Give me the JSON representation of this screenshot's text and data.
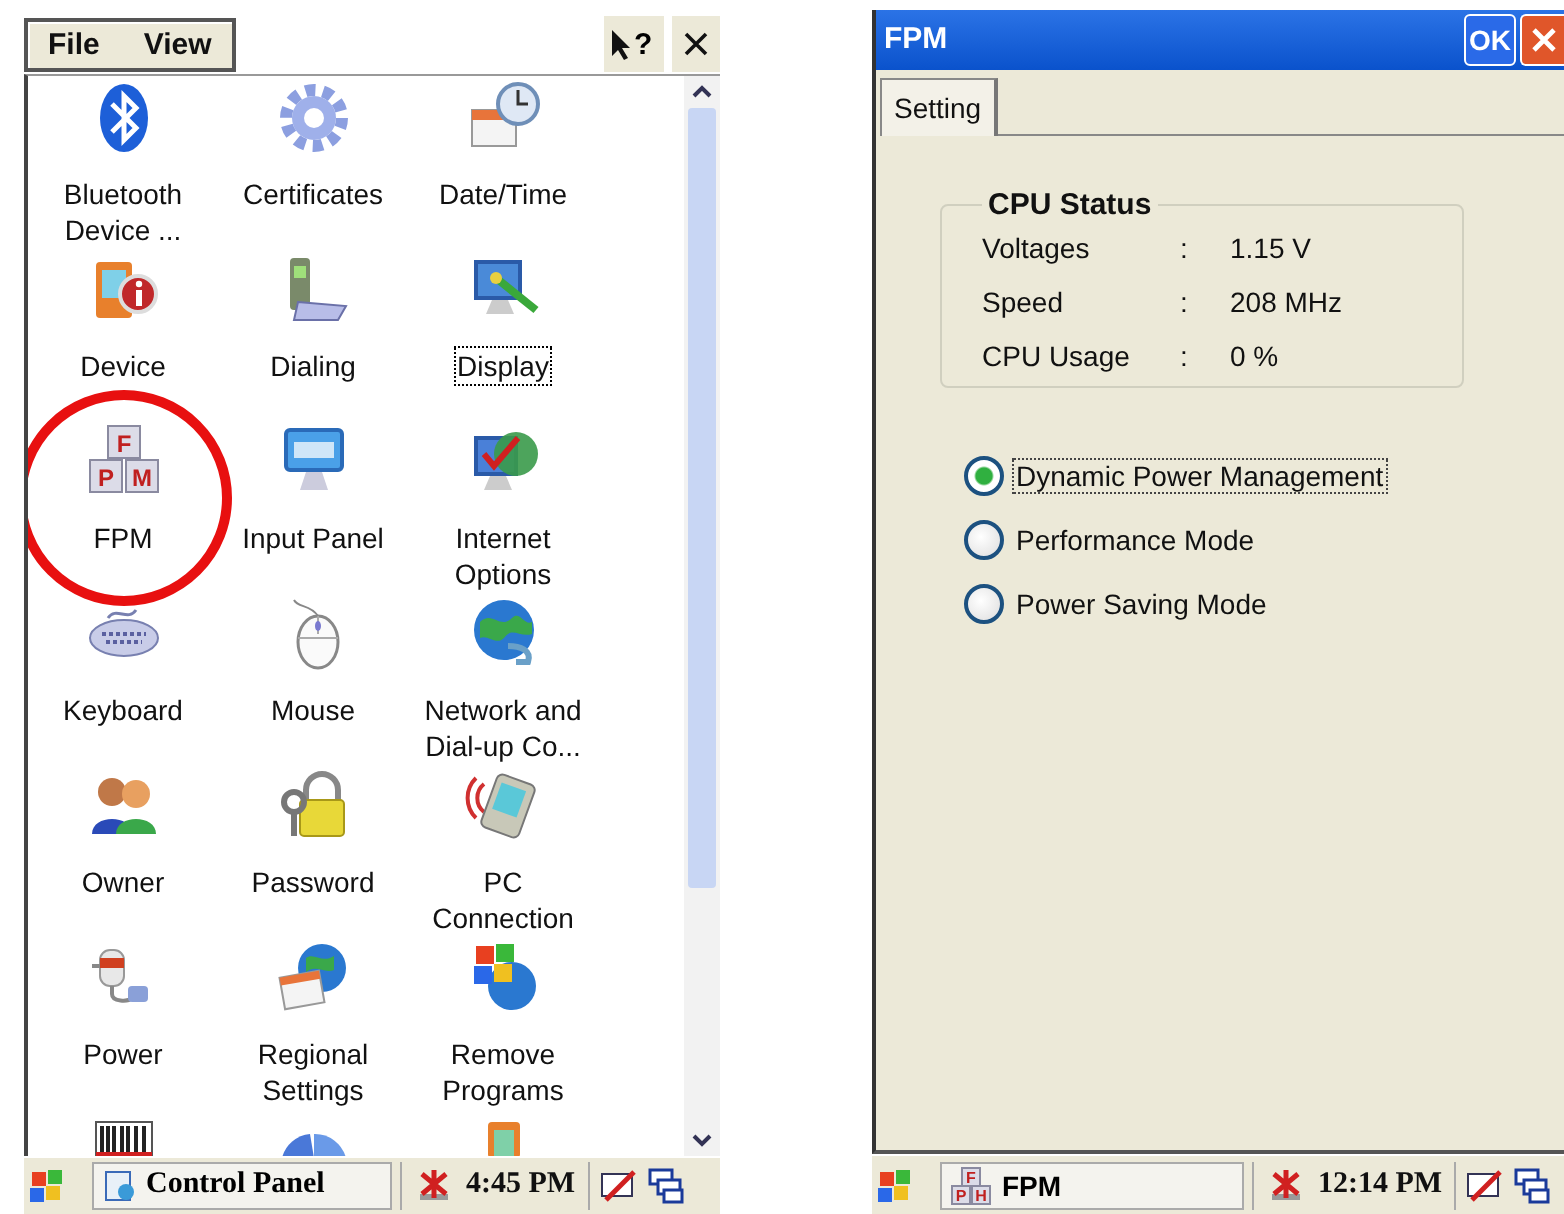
{
  "control_panel": {
    "menu": [
      {
        "label": "File"
      },
      {
        "label": "View"
      }
    ],
    "help_glyph": "?",
    "items": [
      {
        "label": "Bluetooth Device ...",
        "kind": "bluetooth",
        "selected": false,
        "circled": false
      },
      {
        "label": "Certificates",
        "kind": "gear",
        "selected": false,
        "circled": false
      },
      {
        "label": "Date/Time",
        "kind": "calendar-clock",
        "selected": false,
        "circled": false
      },
      {
        "label": "Device",
        "kind": "handheld-info",
        "selected": false,
        "circled": false
      },
      {
        "label": "Dialing",
        "kind": "phone-modem",
        "selected": false,
        "circled": false
      },
      {
        "label": "Display",
        "kind": "monitor-wand",
        "selected": true,
        "circled": false
      },
      {
        "label": "FPM",
        "kind": "letter-blocks",
        "icon_letters": [
          "F",
          "P",
          "M"
        ],
        "selected": false,
        "circled": true
      },
      {
        "label": "Input Panel",
        "kind": "monitor",
        "selected": false,
        "circled": false
      },
      {
        "label": "Internet Options",
        "kind": "globe-check",
        "selected": false,
        "circled": false
      },
      {
        "label": "Keyboard",
        "kind": "keyboard",
        "selected": false,
        "circled": false
      },
      {
        "label": "Mouse",
        "kind": "mouse",
        "selected": false,
        "circled": false
      },
      {
        "label": "Network and Dial-up Co...",
        "kind": "globe-cable",
        "selected": false,
        "circled": false
      },
      {
        "label": "Owner",
        "kind": "people",
        "selected": false,
        "circled": false
      },
      {
        "label": "Password",
        "kind": "padlock",
        "selected": false,
        "circled": false
      },
      {
        "label": "PC Connection",
        "kind": "handheld-signal",
        "selected": false,
        "circled": false
      },
      {
        "label": "Power",
        "kind": "power-plug",
        "selected": false,
        "circled": false
      },
      {
        "label": "Regional Settings",
        "kind": "globe-calendar",
        "selected": false,
        "circled": false
      },
      {
        "label": "Remove Programs",
        "kind": "flag-globe",
        "selected": false,
        "circled": false
      },
      {
        "kind": "barcode",
        "selected": false,
        "circled": false
      },
      {
        "kind": "pie",
        "selected": false,
        "circled": false
      },
      {
        "kind": "handheld",
        "selected": false,
        "circled": false
      }
    ],
    "taskbar": {
      "window_button": "Control Panel",
      "time": "4:45 PM"
    }
  },
  "fpm_window": {
    "title": "FPM",
    "ok": "OK",
    "tabs": [
      {
        "label": "Setting",
        "selected": true
      }
    ],
    "group": {
      "title": "CPU Status",
      "rows": [
        {
          "label": "Voltages",
          "sep": ":",
          "value": "1.15 V"
        },
        {
          "label": "Speed",
          "sep": ":",
          "value": "208 MHz"
        },
        {
          "label": "CPU Usage",
          "sep": ":",
          "value": "0 %"
        }
      ]
    },
    "modes": [
      {
        "label": "Dynamic Power Management",
        "selected": true
      },
      {
        "label": "Performance Mode",
        "selected": false
      },
      {
        "label": "Power Saving Mode",
        "selected": false
      }
    ],
    "taskbar": {
      "window_button": "FPM",
      "icon_letters": [
        "F",
        "P",
        "H"
      ],
      "time": "12:14 PM"
    }
  }
}
